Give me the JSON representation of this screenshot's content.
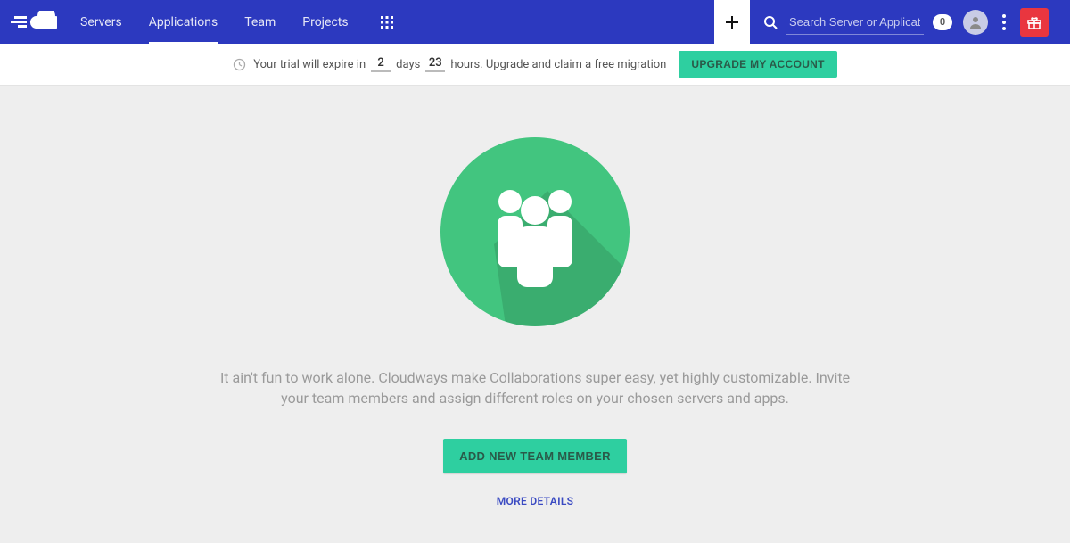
{
  "nav": {
    "items": [
      {
        "label": "Servers"
      },
      {
        "label": "Applications"
      },
      {
        "label": "Team"
      },
      {
        "label": "Projects"
      }
    ],
    "active_index": 1
  },
  "search": {
    "placeholder": "Search Server or Application",
    "badge_count": "0"
  },
  "trial": {
    "prefix": "Your trial will expire in",
    "days_value": "2",
    "days_label": "days",
    "hours_value": "23",
    "hours_suffix": "hours. Upgrade and claim a free migration",
    "upgrade_label": "UPGRADE MY ACCOUNT"
  },
  "team": {
    "description": "It ain't fun to work alone. Cloudways make Collaborations super easy, yet highly customizable. Invite your team members and assign different roles on your chosen servers and apps.",
    "add_button_label": "ADD NEW TEAM MEMBER",
    "more_link_label": "MORE DETAILS"
  },
  "colors": {
    "primary": "#2c39bf",
    "accent": "#2ecfa0",
    "hero_green": "#42c57f",
    "danger": "#e9363f"
  }
}
